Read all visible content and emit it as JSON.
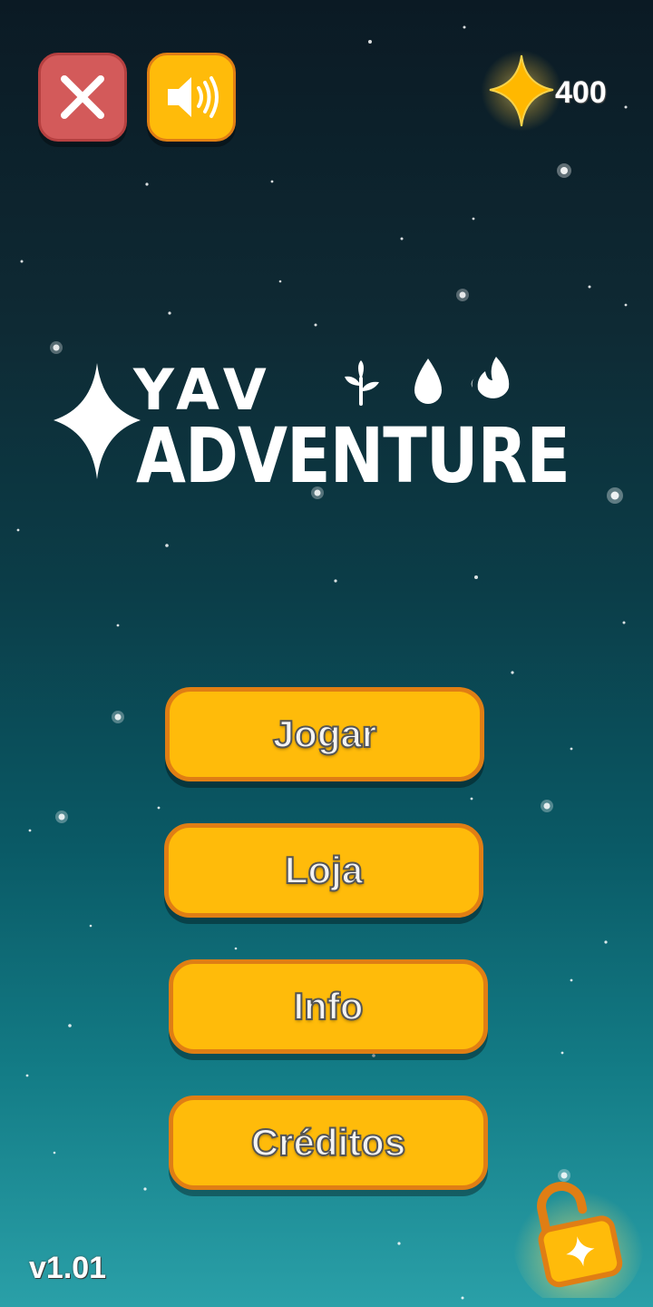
{
  "header": {
    "close_icon": "close-icon",
    "sound_icon": "speaker-icon",
    "star_count": "400"
  },
  "logo": {
    "line1": "YAV",
    "line2": "ADVENTURE",
    "element_icons": [
      "leaf-icon",
      "water-drop-icon",
      "fire-icon"
    ]
  },
  "menu": {
    "play_label": "Jogar",
    "shop_label": "Loja",
    "info_label": "Info",
    "credits_label": "Créditos"
  },
  "footer": {
    "version": "v1.01",
    "unlock_icon": "unlock-icon"
  },
  "colors": {
    "button_fill": "#ffbb0a",
    "button_border": "#e07e14",
    "close_fill": "#d35a5a",
    "text": "#ffffff"
  }
}
